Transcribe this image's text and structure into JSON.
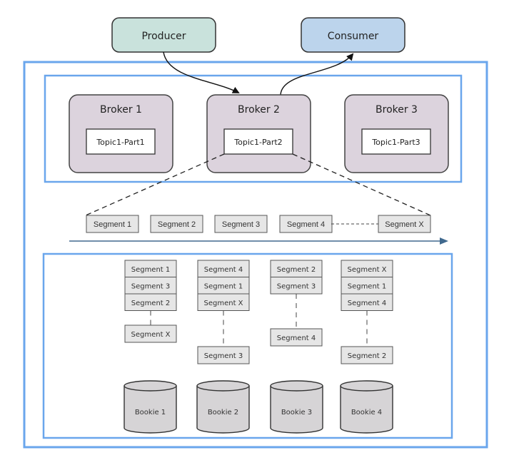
{
  "colors": {
    "producer_fill": "#c9e2dc",
    "consumer_fill": "#bcd4ec",
    "broker_fill": "#dcd3dd",
    "segment_fill": "#e6e6e6",
    "bookie_fill": "#d6d4d6",
    "frame_blue": "#6aa6ec",
    "timeline_blue": "#40698e",
    "stroke_dark": "#3a3a3a"
  },
  "producer": {
    "label": "Producer"
  },
  "consumer": {
    "label": "Consumer"
  },
  "brokers": [
    {
      "label": "Broker 1",
      "topic": "Topic1-Part1"
    },
    {
      "label": "Broker 2",
      "topic": "Topic1-Part2"
    },
    {
      "label": "Broker 3",
      "topic": "Topic1-Part3"
    }
  ],
  "segments_timeline": [
    "Segment 1",
    "Segment 2",
    "Segment 3",
    "Segment 4",
    "Segment X"
  ],
  "bookie_stacks": [
    {
      "stacked": [
        "Segment 1",
        "Segment 3",
        "Segment 2"
      ],
      "last": "Segment X"
    },
    {
      "stacked": [
        "Segment 4",
        "Segment 1",
        "Segment X"
      ],
      "last": "Segment 3"
    },
    {
      "stacked": [
        "Segment 2",
        "Segment 3"
      ],
      "last": "Segment 4"
    },
    {
      "stacked": [
        "Segment X",
        "Segment 1",
        "Segment 4"
      ],
      "last": "Segment 2"
    }
  ],
  "bookies": [
    "Bookie 1",
    "Bookie 2",
    "Bookie 3",
    "Bookie 4"
  ]
}
